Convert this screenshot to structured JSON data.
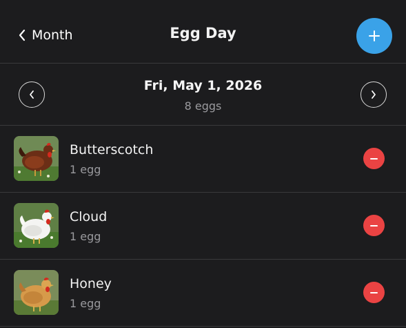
{
  "nav": {
    "back_label": "Month",
    "title": "Egg Day",
    "add_icon": "plus-icon"
  },
  "date": {
    "label": "Fri, May 1, 2026",
    "count": "8 eggs"
  },
  "hens": [
    {
      "name": "Butterscotch",
      "eggs": "1 egg",
      "photo": "brown-hen-photo"
    },
    {
      "name": "Cloud",
      "eggs": "1 egg",
      "photo": "white-hen-photo"
    },
    {
      "name": "Honey",
      "eggs": "1 egg",
      "photo": "buff-hen-photo"
    }
  ],
  "colors": {
    "accent": "#3aa2e8",
    "remove": "#ea4343",
    "background": "#1c1c1e"
  }
}
